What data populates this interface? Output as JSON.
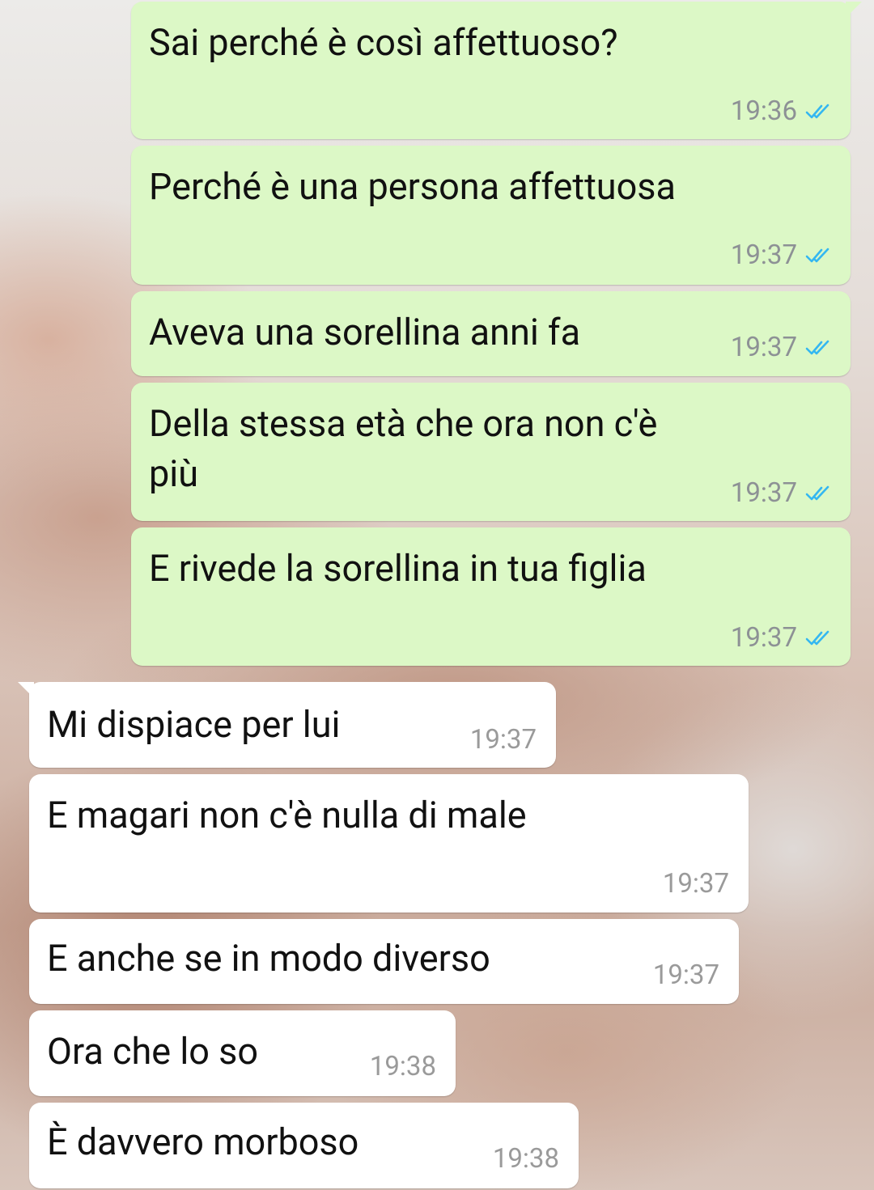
{
  "colors": {
    "outgoing_bubble": "#dcf8c6",
    "incoming_bubble": "#ffffff",
    "read_ticks": "#34b7f1",
    "timestamp": "#8d9195"
  },
  "messages": [
    {
      "direction": "outgoing",
      "text": "Sai perché è così affettuoso?",
      "time": "19:36",
      "status_icon": "double-check-read-icon"
    },
    {
      "direction": "outgoing",
      "text": "Perché è una persona affettuosa",
      "time": "19:37",
      "status_icon": "double-check-read-icon"
    },
    {
      "direction": "outgoing",
      "text": "Aveva una sorellina anni fa",
      "time": "19:37",
      "status_icon": "double-check-read-icon"
    },
    {
      "direction": "outgoing",
      "text": "Della stessa età che ora non c'è\npiù",
      "time": "19:37",
      "status_icon": "double-check-read-icon"
    },
    {
      "direction": "outgoing",
      "text": "E rivede la sorellina in tua figlia",
      "time": "19:37",
      "status_icon": "double-check-read-icon"
    },
    {
      "direction": "incoming",
      "text": "Mi dispiace per lui",
      "time": "19:37"
    },
    {
      "direction": "incoming",
      "text": "E magari non c'è nulla di male",
      "time": "19:37"
    },
    {
      "direction": "incoming",
      "text": "E anche se in modo diverso",
      "time": "19:37"
    },
    {
      "direction": "incoming",
      "text": "Ora che lo so",
      "time": "19:38"
    },
    {
      "direction": "incoming",
      "text": "È davvero morboso",
      "time": "19:38"
    }
  ]
}
